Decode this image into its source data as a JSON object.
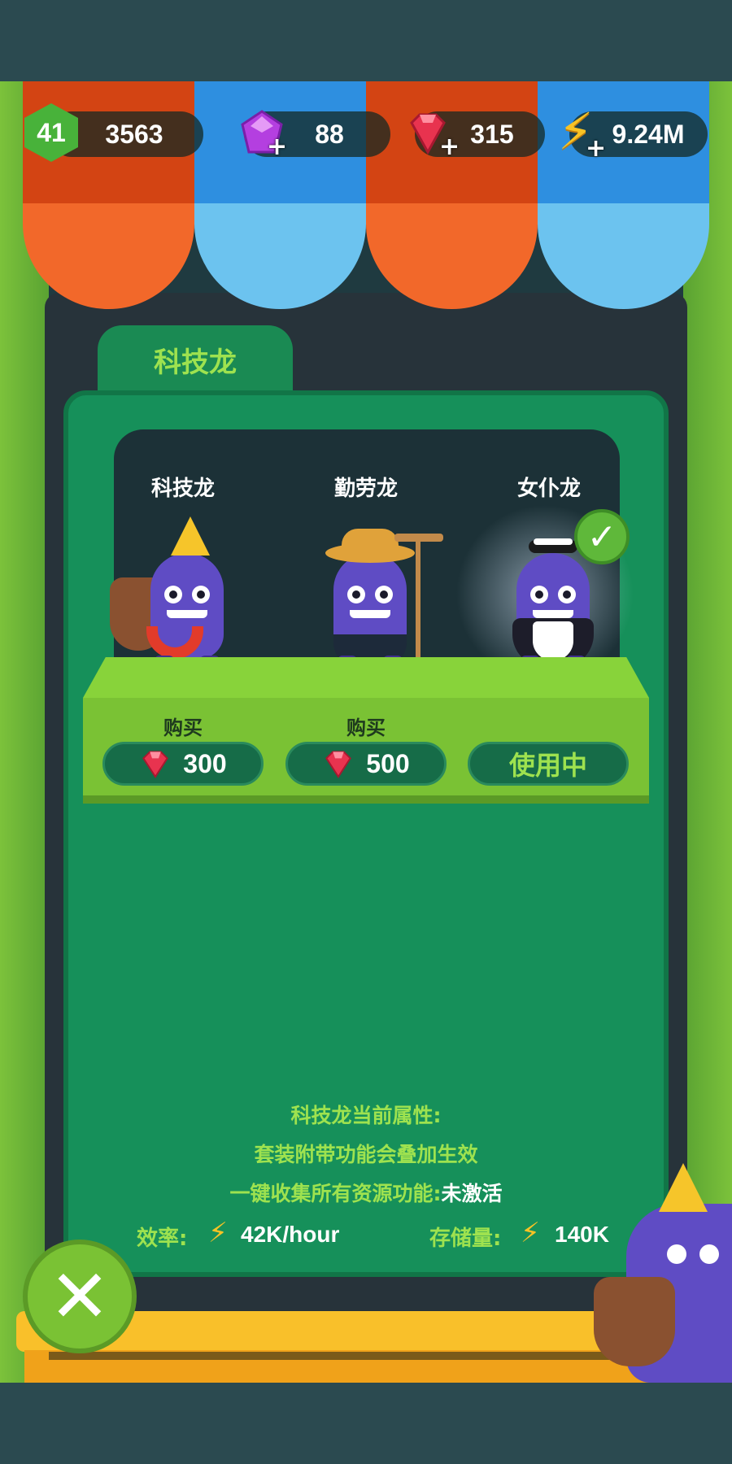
{
  "hud": {
    "level": "41",
    "xp": "3563",
    "purple_gems": "88",
    "red_gems": "315",
    "energy": "9.24M"
  },
  "tab": {
    "label": "科技龙"
  },
  "items": [
    {
      "name": "科技龙",
      "action": "购买",
      "price": "300"
    },
    {
      "name": "勤劳龙",
      "action": "购买",
      "price": "500"
    },
    {
      "name": "女仆龙",
      "status": "使用中"
    }
  ],
  "info": {
    "line1": "科技龙当前属性:",
    "line2": "套装附带功能会叠加生效",
    "line3_label": "一键收集所有资源功能:",
    "line3_value": "未激活",
    "efficiency_label": "效率:",
    "efficiency_value": "42K/hour",
    "storage_label": "存储量:",
    "storage_value": "140K"
  },
  "icons": {
    "close": "close-icon",
    "check": "check-icon",
    "bolt": "lightning-icon",
    "ruby": "ruby-gem-icon",
    "amethyst": "purple-gem-icon"
  },
  "colors": {
    "board_green": "#16905a",
    "accent_lime": "#9ee24f",
    "awning_orange": "#f2682a",
    "awning_blue": "#6cc3ef",
    "bolt_yellow": "#f7c325"
  }
}
